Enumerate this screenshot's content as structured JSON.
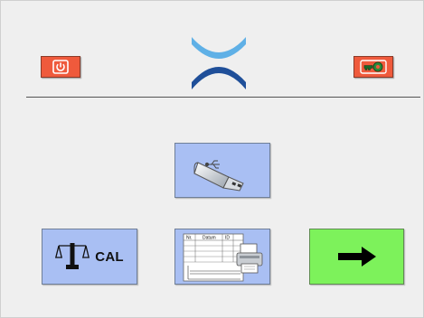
{
  "toolbar": {
    "power": {
      "icon": "power-icon",
      "color": "#ef5a3c"
    },
    "login": {
      "icon": "key-icon",
      "color": "#ef5a3c"
    }
  },
  "logo": {
    "icon": "brand-logo",
    "colors": [
      "#5fb0e6",
      "#1f4f99"
    ]
  },
  "actions": {
    "usb": {
      "icon": "usb-drive-icon",
      "color": "#a9bff3"
    },
    "calibration": {
      "icon": "balance-scale-icon",
      "label": "CAL",
      "color": "#a9bff3"
    },
    "report": {
      "icon": "table-printer-icon",
      "table_headers": [
        "Nr.",
        "Datum",
        "ID"
      ],
      "color": "#a9bff3"
    },
    "next": {
      "icon": "arrow-right-icon",
      "color": "#7df25b"
    }
  }
}
